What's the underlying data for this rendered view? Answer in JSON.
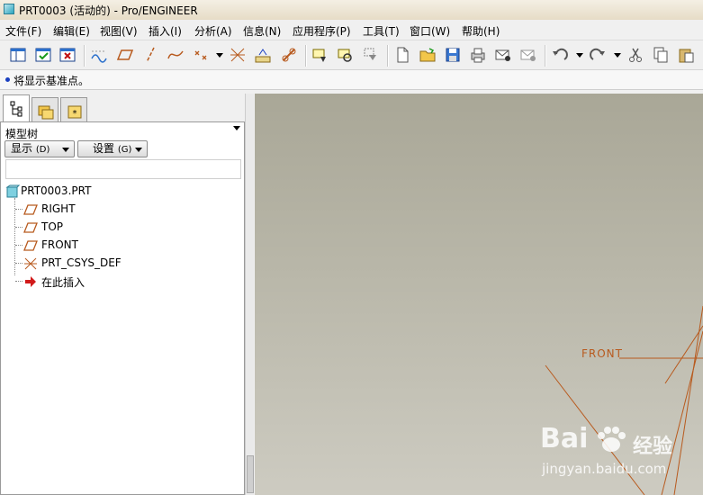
{
  "window": {
    "title": "PRT0003 (活动的) - Pro/ENGINEER"
  },
  "menu": [
    "文件(F)",
    "编辑(E)",
    "视图(V)",
    "插入(I)",
    "分析(A)",
    "信息(N)",
    "应用程序(P)",
    "工具(T)",
    "窗口(W)",
    "帮助(H)"
  ],
  "message": {
    "text": "将显示基准点。"
  },
  "model_tree": {
    "header": "模型树",
    "show_button": {
      "label": "显示",
      "key": "(D)"
    },
    "settings_button": {
      "label": "设置",
      "key": "(G)"
    },
    "root": "PRT0003.PRT",
    "items": [
      "RIGHT",
      "TOP",
      "FRONT",
      "PRT_CSYS_DEF",
      "在此插入"
    ]
  },
  "graphics": {
    "front_label": "FRONT"
  },
  "watermark": {
    "brand": "Bai",
    "brand_suffix": "经验",
    "url": "jingyan.baidu.com"
  },
  "colors": {
    "datum": "#b85a1e",
    "insert_arrow": "#d11a1a",
    "graphics_top": "#a9a797",
    "graphics_bottom": "#cdcbc1"
  }
}
